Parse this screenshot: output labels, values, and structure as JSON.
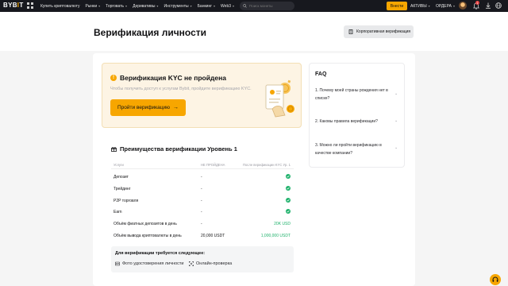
{
  "colors": {
    "accent": "#f7a600",
    "nav_bg": "#17181e",
    "success": "#20b26c",
    "kyc_card_bg": "#fdf4e4"
  },
  "nav": {
    "logo": "BYB",
    "logo_tail": "T",
    "items": [
      {
        "label": "Купить криптовалюту",
        "has_chevron": false
      },
      {
        "label": "Рынки",
        "has_chevron": true
      },
      {
        "label": "Торговать",
        "has_chevron": true
      },
      {
        "label": "Деривативы",
        "has_chevron": true
      },
      {
        "label": "Инструменты",
        "has_chevron": true
      },
      {
        "label": "Банкинг",
        "has_chevron": true
      },
      {
        "label": "Web3",
        "has_chevron": true
      }
    ],
    "search_placeholder": "Поиск монеты",
    "login_label": "Внести",
    "assets_label": "АКТИВЫ",
    "orders_label": "ОРДЕРА",
    "notification_count": "1"
  },
  "header": {
    "title": "Верификация личности",
    "corporate_button": "Корпоративная верификация"
  },
  "kyc": {
    "title": "Верификация KYC не пройдена",
    "description": "Чтобы получить доступ к услугам Bybit, пройдите верификацию KYC.",
    "button": "Пройти верификацию",
    "button_arrow": "→"
  },
  "benefits": {
    "title": "Преимущества верификации Уровень 1",
    "columns": [
      "Услуги",
      "НЕ ПРОЙДЕНА",
      "После верификации KYC Ур. 1"
    ],
    "rows": [
      {
        "service": "Депозит",
        "current": "-",
        "after": "",
        "after_check": true
      },
      {
        "service": "Трейдинг",
        "current": "-",
        "after": "",
        "after_check": true
      },
      {
        "service": "P2P торговля",
        "current": "-",
        "after": "",
        "after_check": true
      },
      {
        "service": "Earn",
        "current": "-",
        "after": "",
        "after_check": true
      },
      {
        "service": "Объём фиатных депозитов в день",
        "current": "-",
        "after": "20K USD",
        "after_check": false
      },
      {
        "service": "Объём вывода криптовалюты в день",
        "current": "20,000 USDT",
        "after": "1,000,000 USDT",
        "after_check": false
      }
    ]
  },
  "requirements": {
    "title": "Для верификации требуется следующее:",
    "items": [
      {
        "label": "Фото удостоверения личности",
        "icon": "id-card-icon"
      },
      {
        "label": "Онлайн-проверка",
        "icon": "scan-icon"
      }
    ]
  },
  "faq": {
    "title": "FAQ",
    "items": [
      {
        "q1": "1. Почему моей страны рождения нет в",
        "q2": "списке?"
      },
      {
        "q1": "2. Каковы правила верификации?",
        "q2": ""
      },
      {
        "q1": "3. Можно ли пройти верификацию в",
        "q2": "качестве компании?"
      }
    ]
  }
}
